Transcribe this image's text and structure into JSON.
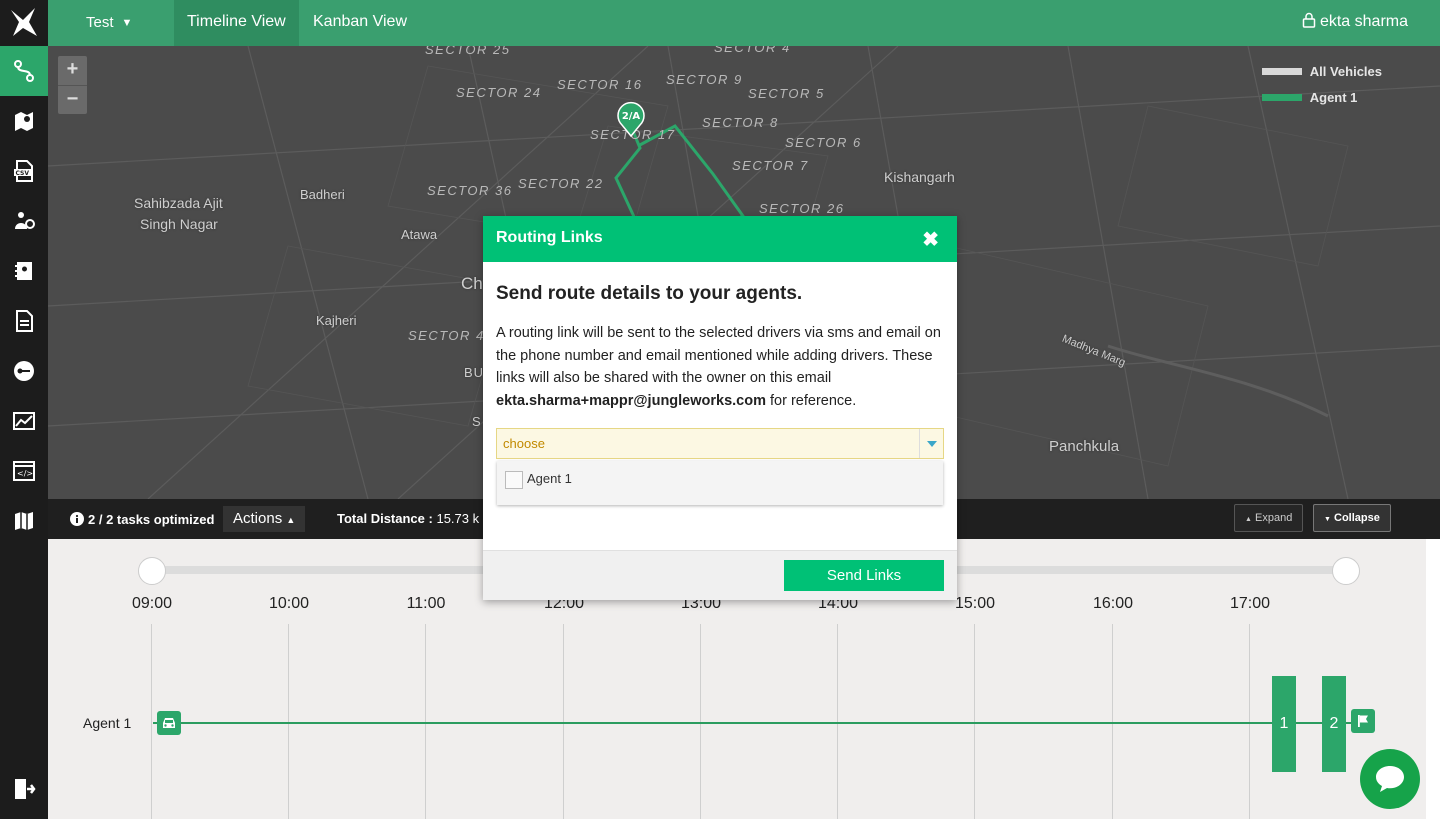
{
  "sidebar": {
    "items": [
      {
        "icon": "route-icon",
        "active": true
      },
      {
        "icon": "map-pins-icon"
      },
      {
        "icon": "csv-icon"
      },
      {
        "icon": "agents-icon"
      },
      {
        "icon": "address-book-icon"
      },
      {
        "icon": "document-icon"
      },
      {
        "icon": "key-icon"
      },
      {
        "icon": "analytics-icon"
      },
      {
        "icon": "api-icon"
      },
      {
        "icon": "map-icon"
      }
    ],
    "logout_icon": "logout-icon"
  },
  "header": {
    "team": "Test",
    "tabs": [
      {
        "label": "Timeline View"
      },
      {
        "label": "Kanban View"
      }
    ],
    "user": "ekta sharma"
  },
  "map": {
    "places": {
      "sahibzada1": "Sahibzada Ajit",
      "sahibzada2": "Singh Nagar",
      "badheri": "Badheri",
      "atawa": "Atawa",
      "kajheri": "Kajheri",
      "kishangarh": "Kishangarh",
      "panchkula": "Panchkula",
      "madhya": "Madhya Marg",
      "ch": "Ch",
      "bu": "BU",
      "s": "S"
    },
    "sectors": {
      "s25": "SECTOR 25",
      "s4": "SECTOR 4",
      "s16": "SECTOR 16",
      "s9": "SECTOR 9",
      "s24": "SECTOR 24",
      "s5": "SECTOR 5",
      "s17": "SECTOR 17",
      "s8": "SECTOR 8",
      "s6": "SECTOR 6",
      "s7": "SECTOR 7",
      "s36": "SECTOR 36",
      "s22": "SECTOR 22",
      "s26": "SECTOR 26",
      "s44": "SECTOR 44"
    },
    "pin_label": "2/A",
    "legend": [
      {
        "label": "All Vehicles",
        "color": "#d9d9d9"
      },
      {
        "label": "Agent 1",
        "color": "#2ca66a"
      }
    ]
  },
  "status_bar": {
    "optimized": "2 / 2 tasks optimized",
    "actions": "Actions",
    "distance_label": "Total Distance :",
    "distance_value": "15.73 k",
    "expand": "Expand",
    "collapse": "Collapse"
  },
  "timeline": {
    "hours": [
      "09:00",
      "10:00",
      "11:00",
      "12:00",
      "13:00",
      "14:00",
      "15:00",
      "16:00",
      "17:00"
    ],
    "agent": "Agent 1",
    "tasks": [
      "1",
      "2"
    ]
  },
  "modal": {
    "title": "Routing Links",
    "heading": "Send route details to your agents.",
    "text_pre": "A routing link will be sent to the selected drivers via sms and email on the phone number and email mentioned while adding drivers. These links will also be shared with the owner on this email ",
    "email": "ekta.sharma+mappr@jungleworks.com",
    "text_post": " for reference.",
    "select_value": "choose",
    "options": [
      {
        "label": "Agent 1",
        "checked": false
      }
    ],
    "send_button": "Send Links"
  },
  "colors": {
    "primary": "#00c176",
    "topbar": "#3a9f6f",
    "sidebar": "#1c1c1c"
  }
}
